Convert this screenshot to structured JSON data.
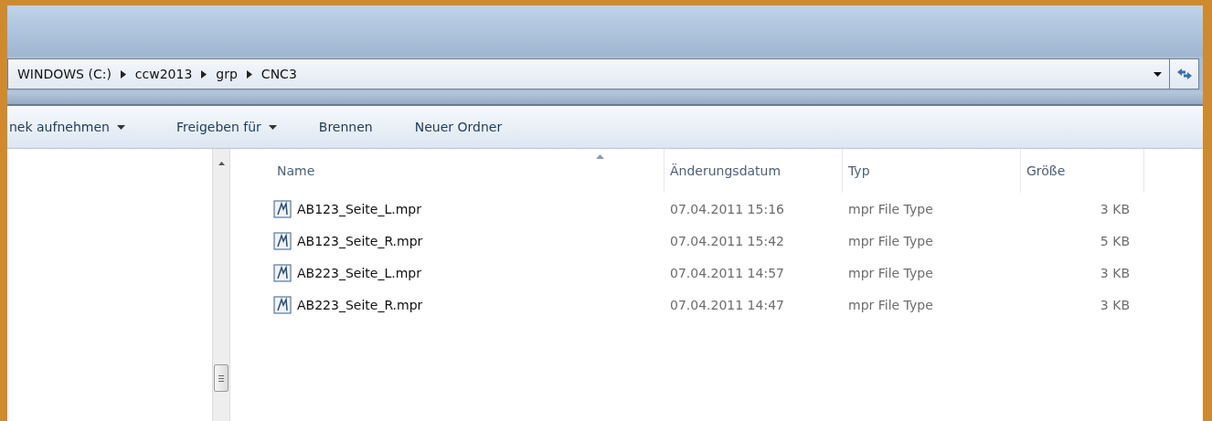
{
  "breadcrumb": [
    "WINDOWS (C:)",
    "ccw2013",
    "grp",
    "CNC3"
  ],
  "toolbar": [
    {
      "label": "nek aufnehmen",
      "dropdown": true
    },
    {
      "label": "Freigeben für",
      "dropdown": true
    },
    {
      "label": "Brennen",
      "dropdown": false
    },
    {
      "label": "Neuer Ordner",
      "dropdown": false
    }
  ],
  "columns": [
    "Name",
    "Änderungsdatum",
    "Typ",
    "Größe"
  ],
  "rows": [
    {
      "name": "AB123_Seite_L.mpr",
      "date": "07.04.2011 15:16",
      "type": "mpr File Type",
      "size": "3 KB"
    },
    {
      "name": "AB123_Seite_R.mpr",
      "date": "07.04.2011 15:42",
      "type": "mpr File Type",
      "size": "5 KB"
    },
    {
      "name": "AB223_Seite_L.mpr",
      "date": "07.04.2011 14:57",
      "type": "mpr File Type",
      "size": "3 KB"
    },
    {
      "name": "AB223_Seite_R.mpr",
      "date": "07.04.2011 14:47",
      "type": "mpr File Type",
      "size": "3 KB"
    }
  ]
}
